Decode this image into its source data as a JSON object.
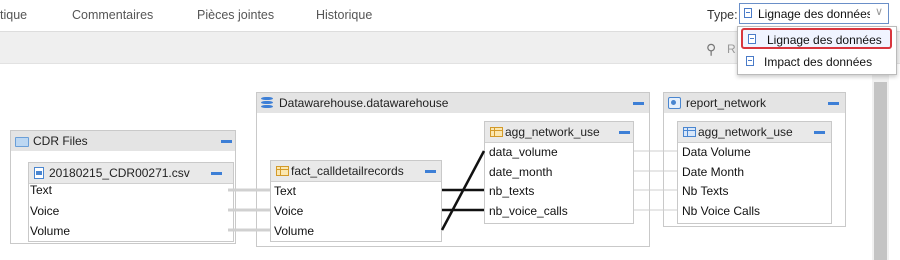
{
  "tabs": [
    {
      "label": "tique"
    },
    {
      "label": "Commentaires"
    },
    {
      "label": "Pièces jointes"
    },
    {
      "label": "Historique"
    }
  ],
  "type_selector": {
    "label": "Type:",
    "value": "Lignage des données"
  },
  "dropdown": {
    "options": [
      {
        "label": "Lignage des données",
        "selected": true
      },
      {
        "label": "Impact des données",
        "selected": false
      }
    ]
  },
  "toolbar": {
    "search_hint": "R"
  },
  "diagram": {
    "cdr_group": {
      "title": "CDR Files",
      "file": {
        "title": "20180215_CDR00271.csv",
        "fields": [
          "Text",
          "Voice",
          "Volume"
        ]
      }
    },
    "dw_group": {
      "title": "Datawarehouse.datawarehouse",
      "fact_table": {
        "title": "fact_calldetailrecords",
        "fields": [
          "Text",
          "Voice",
          "Volume"
        ]
      },
      "agg_table": {
        "title": "agg_network_use",
        "fields": [
          "data_volume",
          "date_month",
          "nb_texts",
          "nb_voice_calls"
        ]
      }
    },
    "report_group": {
      "title": "report_network",
      "agg_table": {
        "title": "agg_network_use",
        "fields": [
          "Data Volume",
          "Date Month",
          "Nb Texts",
          "Nb Voice Calls"
        ]
      }
    }
  },
  "colors": {
    "accent": "#3d7fd6",
    "highlight": "#d9363e"
  }
}
